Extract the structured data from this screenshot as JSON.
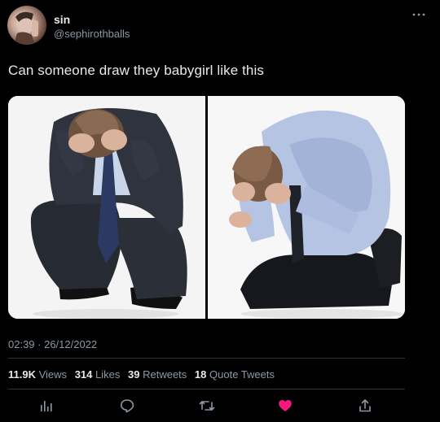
{
  "user": {
    "display_name": "sin",
    "handle": "@sephirothballs"
  },
  "tweet": {
    "text": "Can someone draw they babygirl like this",
    "timestamp": "02:39 · 26/12/2022"
  },
  "stats": {
    "views_count": "11.9K",
    "views_label": "Views",
    "likes_count": "314",
    "likes_label": "Likes",
    "retweets_count": "39",
    "retweets_label": "Retweets",
    "quotes_count": "18",
    "quotes_label": "Quote Tweets"
  },
  "icons": {
    "more": "more-icon",
    "analytics": "analytics-icon",
    "reply": "reply-icon",
    "retweet": "retweet-icon",
    "like": "heart-icon",
    "share": "share-icon"
  },
  "colors": {
    "background": "#000000",
    "text_primary": "#e7e9ea",
    "text_secondary": "#8b98a5",
    "divider": "#2f3336",
    "like_active": "#f91880"
  }
}
